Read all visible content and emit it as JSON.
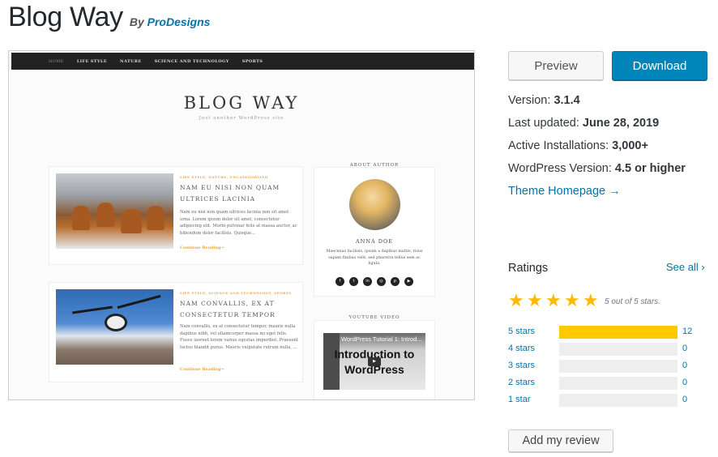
{
  "header": {
    "title": "Blog Way",
    "by_label": "By",
    "author": "ProDesigns"
  },
  "screenshot": {
    "nav": [
      "HOME",
      "LIFE STYLE",
      "NATURE",
      "SCIENCE AND TECHNOLOGY",
      "SPORTS"
    ],
    "blog_title": "BLOG WAY",
    "tagline": "Just another WordPress site",
    "posts": [
      {
        "categories": "LIFE STYLE, NATURE, UNCATEGORIZED",
        "title": "NAM EU NISI NON QUAM ULTRICES LACINIA",
        "excerpt": "Nam eu nisi non quam ultrices lacinia non sit amet urna. Lorem ipsum dolor sit amet, consectetur adipiscing elit. Morbi pulvinar felis at massa auctor, ac bibendum dolor facilisis. Quisque…",
        "more": "Continue Reading→",
        "image": "deer-in-snow"
      },
      {
        "categories": "LIFE STYLE, SCIENCE AND TECHNOLOGY, SPORTS",
        "title": "NAM CONVALLIS, EX AT CONSECTETUR TEMPOR",
        "excerpt": "Nam convallis, ex at consectetur tempor, mauris nulla dapibus nibh, vel ullamcorper massa mi eget felis. Fusce laoreet lorem varius egestas imperdiet. Praesent luctus blandit purus. Mauris vulputate rutrum nulla, …",
        "more": "Continue Reading→",
        "image": "drone-over-mountains"
      }
    ],
    "author_widget": {
      "title": "ABOUT AUTHOR",
      "name": "ANNA DOE",
      "bio": "Maecenas facilisis, ipsum a dapibus mattis, risus sapien finibus velit, sed pharetra tellus sem ac ligula.",
      "socials": [
        {
          "icon": "facebook-icon",
          "glyph": "f"
        },
        {
          "icon": "twitter-icon",
          "glyph": "t"
        },
        {
          "icon": "linkedin-icon",
          "glyph": "in"
        },
        {
          "icon": "instagram-icon",
          "glyph": "◎"
        },
        {
          "icon": "pinterest-icon",
          "glyph": "p"
        },
        {
          "icon": "youtube-icon",
          "glyph": "▶"
        }
      ]
    },
    "video_widget": {
      "title": "YOUTUBE VIDEO",
      "video_top": "WordPress Tutorial 1: Introd...",
      "video_big": "Introduction to WordPress",
      "play_glyph": "▶"
    }
  },
  "actions": {
    "preview": "Preview",
    "download": "Download"
  },
  "meta": {
    "version_label": "Version:",
    "version": "3.1.4",
    "updated_label": "Last updated:",
    "updated": "June 28, 2019",
    "installs_label": "Active Installations:",
    "installs": "3,000+",
    "wp_label": "WordPress Version:",
    "wp": "4.5 or higher",
    "homepage": "Theme Homepage →"
  },
  "ratings": {
    "heading": "Ratings",
    "see_all": "See all ›",
    "stars_glyph": "★",
    "stars_value": 5,
    "stars_text": "5 out of 5 stars.",
    "rows": [
      {
        "label": "5 stars",
        "count": "12",
        "fraction": 1.0
      },
      {
        "label": "4 stars",
        "count": "0",
        "fraction": 0
      },
      {
        "label": "3 stars",
        "count": "0",
        "fraction": 0
      },
      {
        "label": "2 stars",
        "count": "0",
        "fraction": 0
      },
      {
        "label": "1 star",
        "count": "0",
        "fraction": 0
      }
    ],
    "add_review": "Add my review"
  },
  "colors": {
    "link": "#0073aa",
    "primary_button": "#0085ba",
    "star": "#ffb900",
    "bar_fill": "#ffc800",
    "bar_track": "#eeeeee"
  }
}
